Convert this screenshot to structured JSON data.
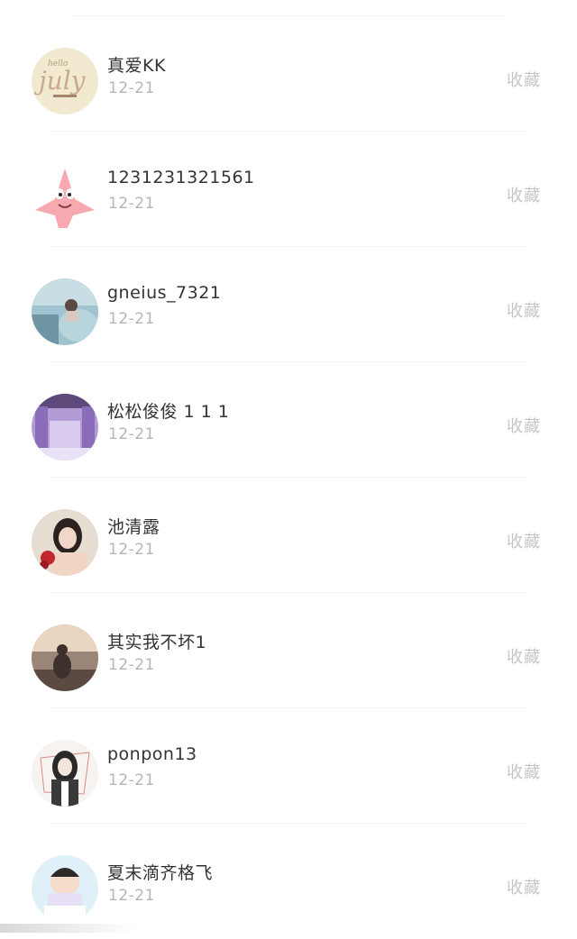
{
  "list": {
    "items": [
      {
        "name": "真爱KK",
        "date": "12-21",
        "action": "收藏",
        "avatar_icon": "hello-july-text-avatar"
      },
      {
        "name": "1231231321561",
        "date": "12-21",
        "action": "收藏",
        "avatar_icon": "pink-starfish-cartoon-avatar"
      },
      {
        "name": "gneius_7321",
        "date": "12-21",
        "action": "收藏",
        "avatar_icon": "blue-scenery-photo-avatar"
      },
      {
        "name": "松松俊俊 1 1 1",
        "date": "12-21",
        "action": "收藏",
        "avatar_icon": "purple-stage-curtain-avatar"
      },
      {
        "name": "池清露",
        "date": "12-21",
        "action": "收藏",
        "avatar_icon": "girl-with-rose-avatar"
      },
      {
        "name": "其实我不坏1",
        "date": "12-21",
        "action": "收藏",
        "avatar_icon": "seaside-sunset-silhouette-avatar"
      },
      {
        "name": "ponpon13",
        "date": "12-21",
        "action": "收藏",
        "avatar_icon": "anime-girl-drawing-avatar"
      },
      {
        "name": "夏末滴齐格飞",
        "date": "12-21",
        "action": "收藏",
        "avatar_icon": "child-with-sign-avatar"
      }
    ]
  },
  "colors": {
    "name_text": "#333333",
    "date_text": "#b5b5b5",
    "action_text": "#c6c6c6",
    "divider": "#ededed"
  }
}
